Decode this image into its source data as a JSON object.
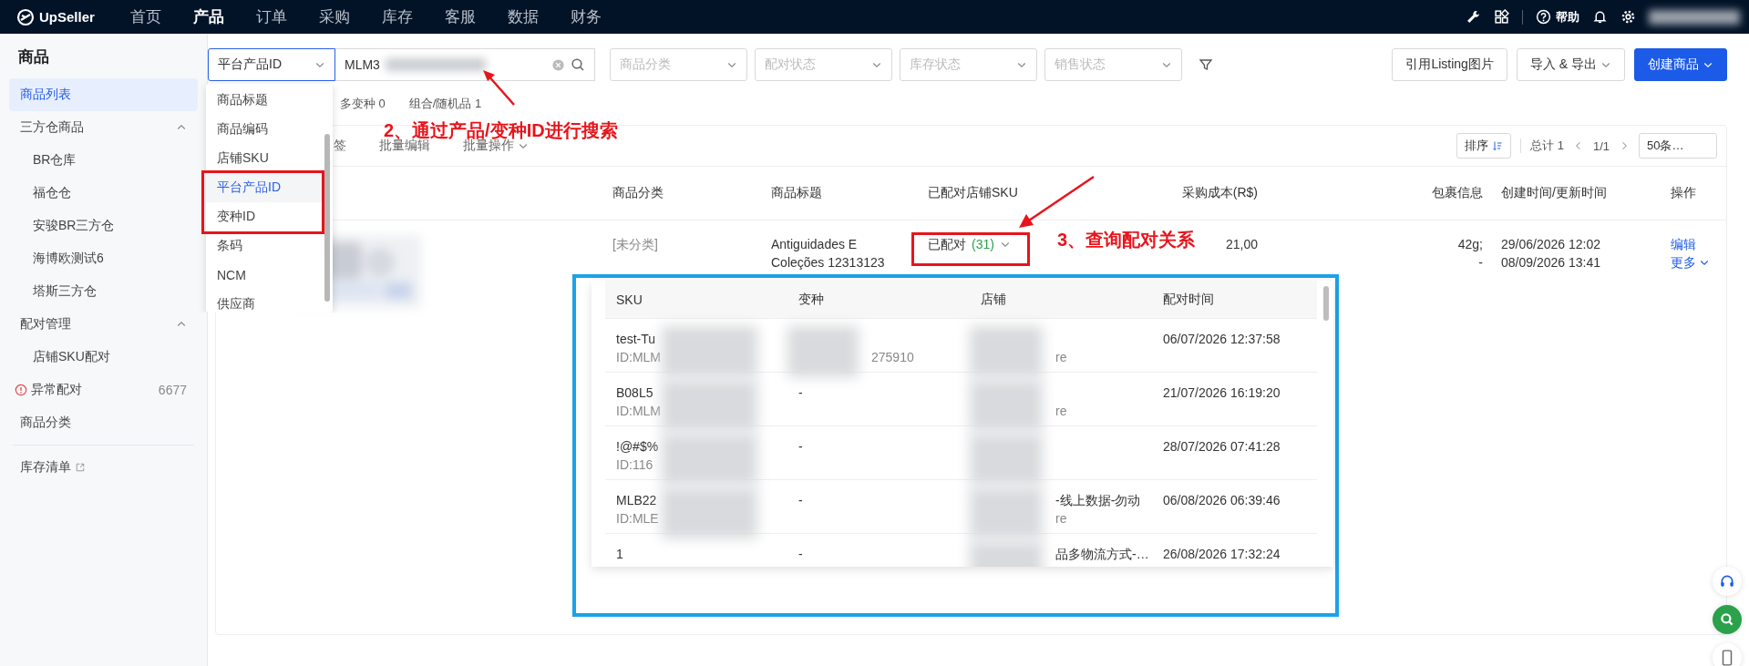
{
  "top_nav": {
    "logo": "UpSeller",
    "items": [
      {
        "label": "首页",
        "selected": false
      },
      {
        "label": "产品",
        "selected": true
      },
      {
        "label": "订单",
        "selected": false
      },
      {
        "label": "采购",
        "selected": false
      },
      {
        "label": "库存",
        "selected": false
      },
      {
        "label": "客服",
        "selected": false
      },
      {
        "label": "数据",
        "selected": false
      },
      {
        "label": "财务",
        "selected": false
      }
    ],
    "help": "帮助"
  },
  "sidebar": {
    "title": "商品",
    "items": [
      {
        "label": "商品列表",
        "kind": "link",
        "selected": true
      },
      {
        "label": "三方仓商品",
        "kind": "group",
        "selected": false,
        "expanded": true,
        "children": [
          {
            "label": "BR仓库",
            "selected": false
          },
          {
            "label": "福仓仓",
            "selected": false
          },
          {
            "label": "安骏BR三方仓",
            "selected": false
          },
          {
            "label": "海博欧测试6",
            "selected": false
          },
          {
            "label": "塔斯三方仓",
            "selected": false
          }
        ]
      },
      {
        "label": "配对管理",
        "kind": "group",
        "selected": false,
        "expanded": true,
        "children": [
          {
            "label": "店铺SKU配对",
            "selected": false
          }
        ]
      },
      {
        "label": "异常配对",
        "kind": "alert",
        "selected": false,
        "count": "6677"
      },
      {
        "label": "商品分类",
        "kind": "link",
        "selected": false
      },
      {
        "label": "库存清单",
        "kind": "external",
        "selected": false
      }
    ]
  },
  "search": {
    "field_type": "平台产品ID",
    "value": "MLM3"
  },
  "filters": [
    {
      "placeholder": "商品分类"
    },
    {
      "placeholder": "配对状态"
    },
    {
      "placeholder": "库存状态"
    },
    {
      "placeholder": "销售状态"
    }
  ],
  "actions": [
    {
      "label": "引用Listing图片",
      "kind": "plain"
    },
    {
      "label": "导入 & 导出",
      "kind": "menu"
    },
    {
      "label": "创建商品",
      "kind": "primary"
    }
  ],
  "stats": [
    {
      "label": "多变种",
      "count": "0"
    },
    {
      "label": "组合/随机品",
      "count": "1"
    }
  ],
  "toolbar": [
    {
      "label": "签",
      "kind": "tab"
    },
    {
      "label": "批量编辑",
      "kind": "plain"
    },
    {
      "label": "批量操作",
      "kind": "menu"
    }
  ],
  "pagination": {
    "sort": "排序",
    "total": "总计 1",
    "page": "1/1",
    "page_size": "50条…"
  },
  "table": {
    "columns": [
      "商品分类",
      "商品标题",
      "已配对店铺SKU",
      "采购成本(R$)",
      "包裹信息",
      "创建时间/更新时间",
      "操作"
    ],
    "rows": [
      {
        "image": {
          "kind": "picture"
        },
        "category": "[未分类]",
        "title": "Antiguidades E Coleções 12313123",
        "matched": {
          "label": "已配对",
          "count": "(31)"
        },
        "cost": "21,00",
        "package": [
          "42g;",
          "-"
        ],
        "times": [
          "29/06/2026 12:02",
          "08/09/2026 13:41"
        ],
        "actions": [
          "编辑",
          "更多"
        ]
      }
    ]
  },
  "search_type_menu": {
    "items": [
      {
        "label": "商品标题",
        "selected": false
      },
      {
        "label": "商品编码",
        "selected": false
      },
      {
        "label": "店铺SKU",
        "selected": false
      },
      {
        "label": "平台产品ID",
        "selected": true
      },
      {
        "label": "变种ID",
        "selected": false
      },
      {
        "label": "条码",
        "selected": false
      },
      {
        "label": "NCM",
        "selected": false
      },
      {
        "label": "供应商",
        "selected": false
      }
    ]
  },
  "matched_popup": {
    "columns": [
      "SKU",
      "变种",
      "店铺",
      "配对时间"
    ],
    "rows": [
      {
        "sku": "test-Tu",
        "sku_id": "ID:MLM",
        "variant_id": "275910",
        "shop_sub": "re",
        "time": "06/07/2026 12:37:58"
      },
      {
        "sku": "B08L5",
        "sku_id": "ID:MLM",
        "variant": "-",
        "shop_sub": "re",
        "time": "21/07/2026 16:19:20"
      },
      {
        "sku": "!@#$%",
        "sku_id": "ID:116",
        "variant": "-",
        "time": "28/07/2026 07:41:28"
      },
      {
        "sku": "MLB22",
        "sku_id": "ID:MLE",
        "variant": "-",
        "shop": "-线上数据-勿动",
        "shop_sub": "re",
        "time": "06/08/2026 06:39:46"
      },
      {
        "sku": "1",
        "variant": "-",
        "shop": "品多物流方式-…",
        "time": "26/08/2026 17:32:24"
      }
    ]
  },
  "annotations": [
    {
      "text": "2、通过产品/变种ID进行搜索"
    },
    {
      "text": "3、查询配对关系"
    }
  ]
}
